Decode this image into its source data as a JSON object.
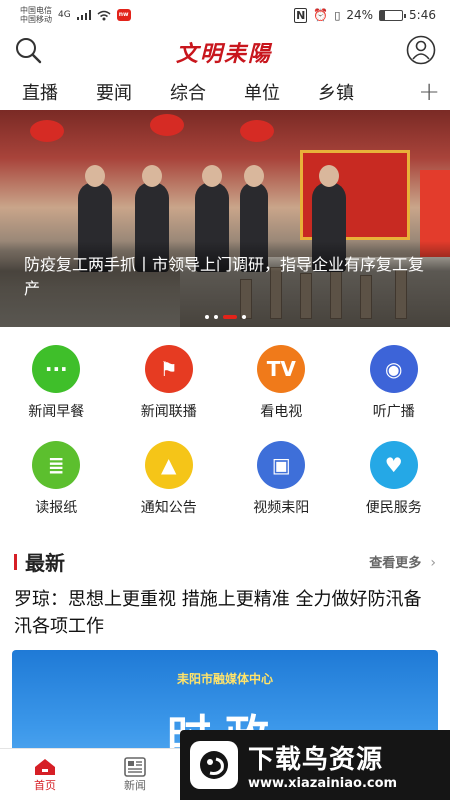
{
  "status_bar": {
    "carrier1": "中国电信",
    "carrier2": "中国移动",
    "signal": "4G",
    "battery": "24%",
    "battery_level": 0.24,
    "time": "5:46"
  },
  "header": {
    "logo": "文明耒陽",
    "search_icon": "search-icon",
    "user_icon": "user-icon"
  },
  "tabs": [
    "直播",
    "要闻",
    "综合",
    "单位",
    "乡镇"
  ],
  "tabs_add": "+",
  "banner": {
    "caption": "防疫复工两手抓丨市领导上门调研，指导企业有序复工复产",
    "slide_count": 4,
    "active_slide": 2
  },
  "grid": [
    {
      "label": "新闻早餐",
      "icon": "message-icon",
      "color": "#3fbf2a",
      "glyph": "···"
    },
    {
      "label": "新闻联播",
      "icon": "flag-icon",
      "color": "#e63b22",
      "glyph": "⚑"
    },
    {
      "label": "看电视",
      "icon": "tv-icon",
      "color": "#f07a1a",
      "glyph": "TV"
    },
    {
      "label": "听广播",
      "icon": "radio-icon",
      "color": "#3d64d8",
      "glyph": "◉"
    },
    {
      "label": "读报纸",
      "icon": "newspaper-icon",
      "color": "#5cbf2e",
      "glyph": "≣"
    },
    {
      "label": "通知公告",
      "icon": "graduation-cap-icon",
      "color": "#f5c518",
      "glyph": "▲"
    },
    {
      "label": "视频耒阳",
      "icon": "book-icon",
      "color": "#3e6fd9",
      "glyph": "▣"
    },
    {
      "label": "便民服务",
      "icon": "heart-icon",
      "color": "#25a8e6",
      "glyph": "♥"
    }
  ],
  "latest": {
    "title": "最新",
    "more": "查看更多",
    "article_title": "罗琼：思想上更重视 措施上更精准 全力做好防汛备汛各项工作",
    "image_org": "耒阳市融媒体中心",
    "image_text": "时政"
  },
  "bottom_nav": [
    {
      "label": "首页",
      "icon": "home-icon",
      "active": true
    },
    {
      "label": "新闻",
      "icon": "news-icon",
      "active": false
    }
  ],
  "watermark": {
    "title": "下载鸟资源",
    "url": "www.xiazainiao.com"
  }
}
